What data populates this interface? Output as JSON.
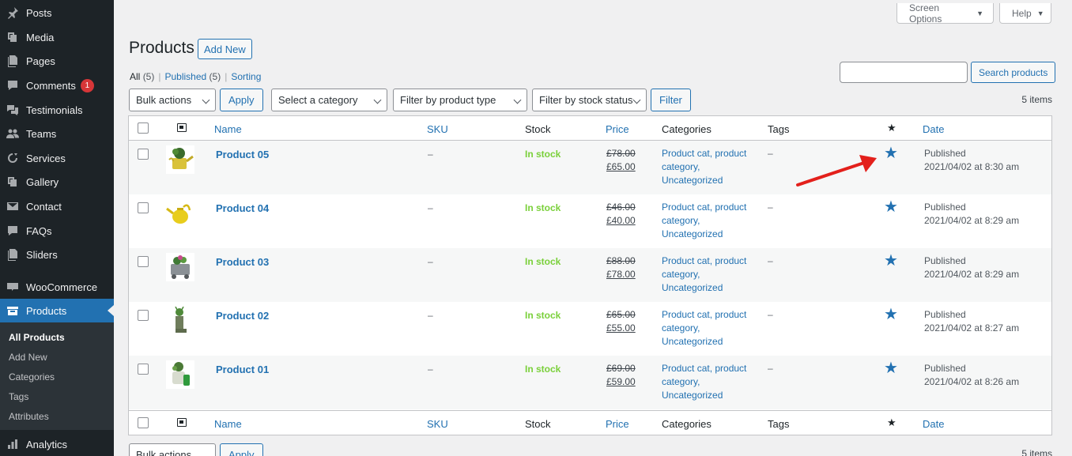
{
  "sidebar": {
    "items": [
      {
        "label": "Posts",
        "icon": "pin-icon"
      },
      {
        "label": "Media",
        "icon": "media-icon"
      },
      {
        "label": "Pages",
        "icon": "pages-icon"
      },
      {
        "label": "Comments",
        "icon": "comments-icon",
        "badge": "1"
      },
      {
        "label": "Testimonials",
        "icon": "testimonials-icon"
      },
      {
        "label": "Teams",
        "icon": "teams-icon"
      },
      {
        "label": "Services",
        "icon": "services-icon"
      },
      {
        "label": "Gallery",
        "icon": "gallery-icon"
      },
      {
        "label": "Contact",
        "icon": "mail-icon"
      },
      {
        "label": "FAQs",
        "icon": "faq-icon"
      },
      {
        "label": "Sliders",
        "icon": "sliders-icon"
      },
      {
        "label": "WooCommerce",
        "icon": "woocommerce-icon"
      },
      {
        "label": "Products",
        "icon": "products-icon"
      },
      {
        "label": "Analytics",
        "icon": "analytics-icon"
      }
    ],
    "submenu": [
      "All Products",
      "Add New",
      "Categories",
      "Tags",
      "Attributes"
    ]
  },
  "top": {
    "screen_options": "Screen Options",
    "help": "Help"
  },
  "header": {
    "title": "Products",
    "add_new": "Add New"
  },
  "views": {
    "all": "All",
    "all_count": "(5)",
    "published": "Published",
    "published_count": "(5)",
    "sorting": "Sorting"
  },
  "search": {
    "placeholder": "",
    "button": "Search products"
  },
  "filters": {
    "bulk_actions": "Bulk actions",
    "apply": "Apply",
    "category": "Select a category",
    "product_type": "Filter by product type",
    "stock_status": "Filter by stock status",
    "filter": "Filter",
    "items_count": "5 items"
  },
  "table": {
    "columns": {
      "name": "Name",
      "sku": "SKU",
      "stock": "Stock",
      "price": "Price",
      "categories": "Categories",
      "tags": "Tags",
      "featured": "★",
      "date": "Date"
    },
    "rows": [
      {
        "name": "Product 05",
        "sku": "–",
        "stock": "In stock",
        "old_price": "£78.00",
        "price": "£65.00",
        "cat1": "Product cat, product",
        "cat2": "category,",
        "cat3": "Uncategorized",
        "tags": "–",
        "status": "Published",
        "date": "2021/04/02 at 8:30 am"
      },
      {
        "name": "Product 04",
        "sku": "–",
        "stock": "In stock",
        "old_price": "£46.00",
        "price": "£40.00",
        "cat1": "Product cat, product",
        "cat2": "category,",
        "cat3": "Uncategorized",
        "tags": "–",
        "status": "Published",
        "date": "2021/04/02 at 8:29 am"
      },
      {
        "name": "Product 03",
        "sku": "–",
        "stock": "In stock",
        "old_price": "£88.00",
        "price": "£78.00",
        "cat1": "Product cat, product",
        "cat2": "category,",
        "cat3": "Uncategorized",
        "tags": "–",
        "status": "Published",
        "date": "2021/04/02 at 8:29 am"
      },
      {
        "name": "Product 02",
        "sku": "–",
        "stock": "In stock",
        "old_price": "£65.00",
        "price": "£55.00",
        "cat1": "Product cat, product",
        "cat2": "category,",
        "cat3": "Uncategorized",
        "tags": "–",
        "status": "Published",
        "date": "2021/04/02 at 8:27 am"
      },
      {
        "name": "Product 01",
        "sku": "–",
        "stock": "In stock",
        "old_price": "£69.00",
        "price": "£59.00",
        "cat1": "Product cat, product",
        "cat2": "category,",
        "cat3": "Uncategorized",
        "tags": "–",
        "status": "Published",
        "date": "2021/04/02 at 8:26 am"
      }
    ]
  },
  "colors": {
    "accent": "#2271b1",
    "sidebar": "#1d2327",
    "in_stock": "#7ad03a",
    "annotation_arrow": "#e3201b"
  }
}
